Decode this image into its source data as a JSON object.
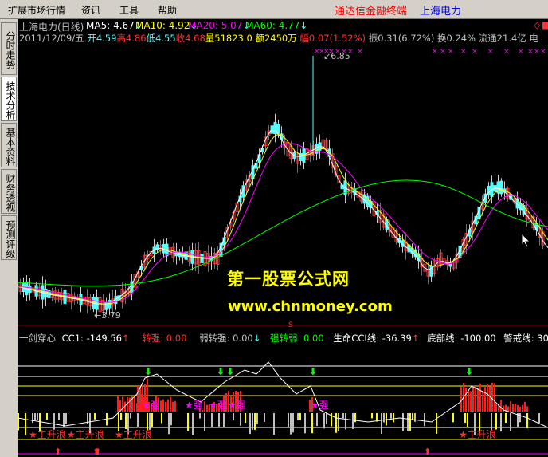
{
  "menu": {
    "items": [
      "扩展市场行情",
      "资讯",
      "工具",
      "帮助"
    ],
    "right_title_1": "通达信金融终端",
    "right_title_2": "上海电力"
  },
  "side_tabs": [
    "分时走势",
    "技术分析",
    "基本资料",
    "财务透视",
    "预测评级"
  ],
  "main_chart": {
    "stock_name": "上海电力(日线)",
    "ma5_label": "MA5:",
    "ma5": "4.67",
    "ma10_label": "MA10:",
    "ma10": "4.92",
    "ma20_label": "MA20:",
    "ma20": "5.07",
    "ma60_label": "MA60:",
    "ma60": "4.77",
    "date": "2011/12/09/五",
    "open": "开4.59",
    "high": "高4.86",
    "low": "低4.55",
    "close": "收4.68",
    "volume": "量51823.0",
    "amount": "额2450万",
    "change": "幅0.07(1.52%)",
    "amplitude": "振0.31(6.72%)",
    "turnover": "换0.24%",
    "float_cap": "流通21.4亿",
    "sector": "电",
    "high_mark": "6.85",
    "low_mark": "3.79",
    "colors": {
      "ma5": "#ffffff",
      "ma10": "#ffff00",
      "ma20": "#ff00ff",
      "ma60": "#00ff00",
      "up": "#ff3232",
      "down": "#54fcfc"
    }
  },
  "watermark": {
    "line1": "第一股票公式网",
    "line2": "www.chnmoney.com"
  },
  "indicator": {
    "name": "一剑穿心",
    "cc1_label": "CC1:",
    "cc1": "-149.56",
    "zhuanqiang_label": "转强:",
    "zhuanqiang": "0.00",
    "ruozhuanqiang_label": "弱转强:",
    "ruozhuanqiang": "0.00",
    "qiangzhuanruo_label": "强转弱:",
    "qiangzhuanruo": "0.00",
    "life_cci_label": "生命CCI线:",
    "life_cci": "-36.39",
    "bottom_label": "底部线:",
    "bottom": "-100.00",
    "warning_label": "警戒线:",
    "warning": "30",
    "signal_strong": "★强",
    "signal_up": "★主升浪"
  }
}
